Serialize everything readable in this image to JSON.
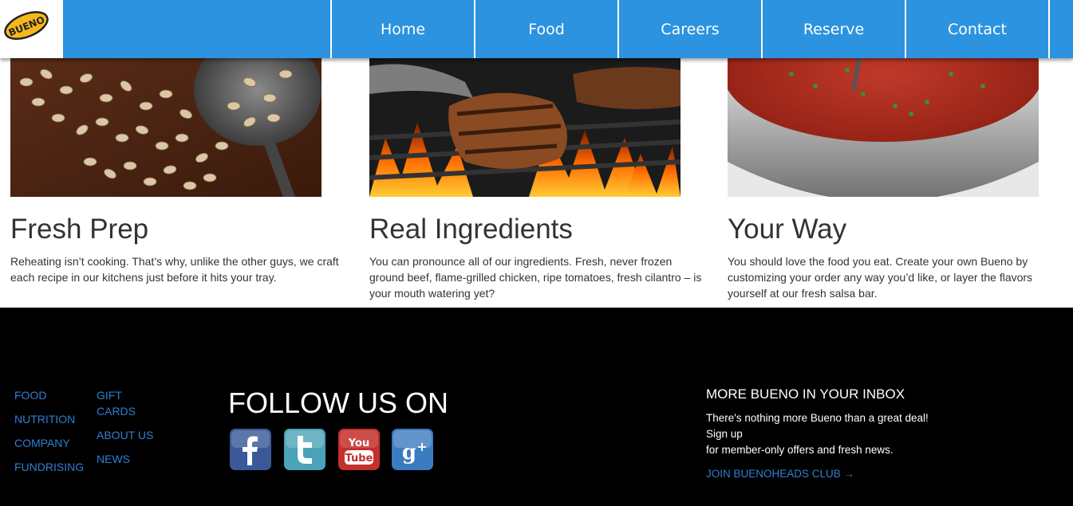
{
  "brand": {
    "logo_text": "BUENO"
  },
  "nav": {
    "items": [
      "Home",
      "Food",
      "Careers",
      "Reserve",
      "Contact"
    ]
  },
  "features": [
    {
      "title": "Fresh Prep",
      "body": "Reheating isn’t cooking. That’s why, unlike the other guys, we craft each recipe in our kitchens just before it hits your tray."
    },
    {
      "title": "Real Ingredients",
      "body": "You can pronounce all of our ingredients. Fresh, never frozen ground beef, flame-grilled chicken, ripe tomatoes, fresh cilantro – is your mouth watering yet?"
    },
    {
      "title": "Your Way",
      "body": "You should love the food you eat. Create your own Bueno by customizing your order any way you’d like, or layer the flavors yourself at our fresh salsa bar."
    }
  ],
  "footer": {
    "links_col1": [
      "FOOD",
      "NUTRITION",
      "COMPANY",
      "FUNDRISING"
    ],
    "links_col2": [
      "GIFT CARDS",
      "ABOUT US",
      "NEWS"
    ],
    "follow_heading": "FOLLOW US ON",
    "social": [
      "facebook",
      "twitter",
      "youtube",
      "google-plus"
    ],
    "inbox": {
      "title": "MORE BUENO IN YOUR INBOX",
      "line1": "There's nothing more Bueno than a great deal!",
      "line2": "Sign up",
      "line3": "for member-only offers and fresh news.",
      "join": "JOIN BUENOHEADS CLUB →"
    }
  },
  "colors": {
    "nav_bg": "#2b93df",
    "footer_bg": "#000000",
    "link": "#2f7fd1",
    "logo_yellow": "#f5b81c"
  }
}
